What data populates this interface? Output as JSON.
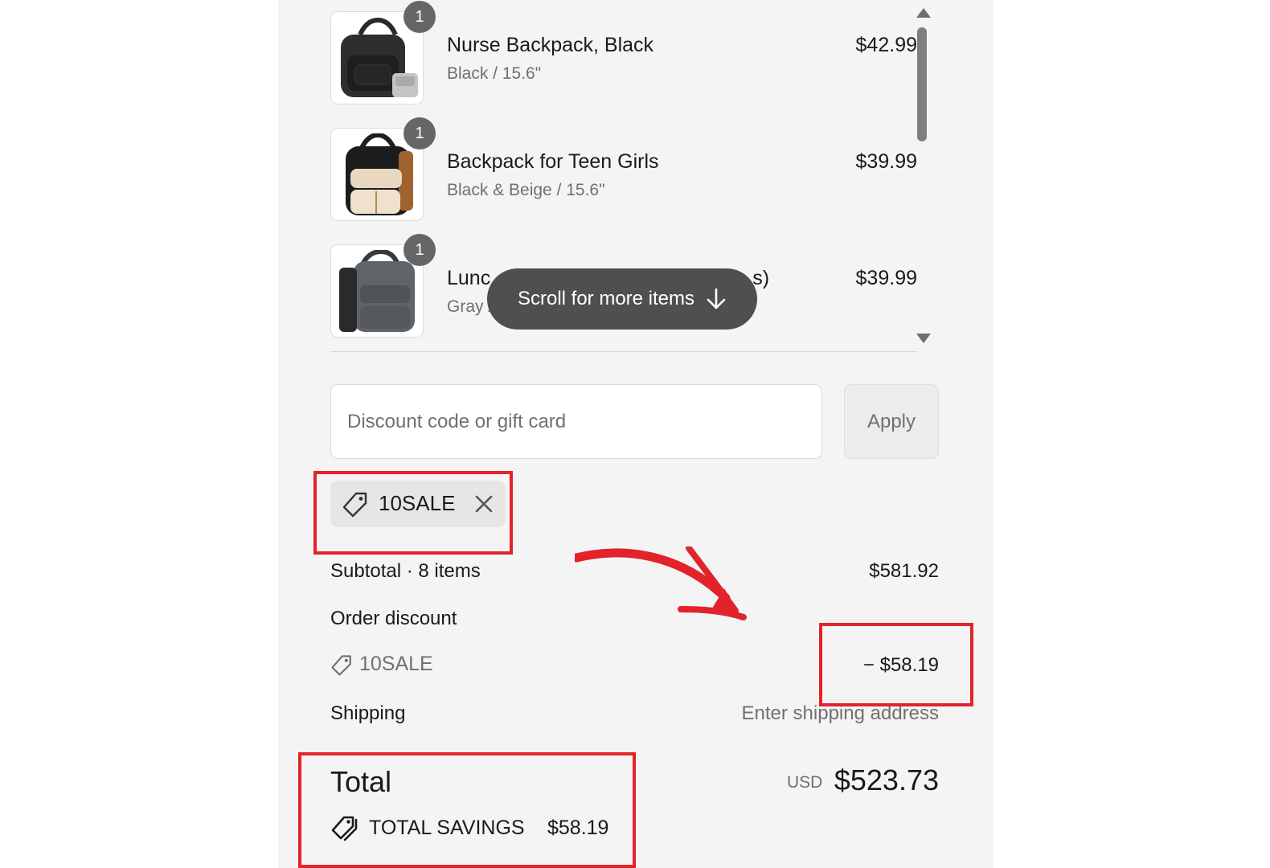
{
  "cart": {
    "items": [
      {
        "name": "Nurse Backpack, Black",
        "variant": "Black / 15.6\"",
        "price": "$42.99",
        "quantity": "1"
      },
      {
        "name": "Backpack for Teen Girls",
        "variant": "Black & Beige / 15.6\"",
        "price": "$39.99",
        "quantity": "1"
      },
      {
        "name_visible_start": "Lunc",
        "name_visible_end": "s)",
        "variant_visible": "Gray /",
        "price": "$39.99",
        "quantity": "1"
      }
    ],
    "scroll_hint": "Scroll for more items"
  },
  "discount": {
    "placeholder": "Discount code or gift card",
    "apply_label": "Apply",
    "applied_code": "10SALE"
  },
  "summary": {
    "subtotal_label": "Subtotal · 8 items",
    "subtotal_value": "$581.92",
    "order_discount_label": "Order discount",
    "order_discount_code": "10SALE",
    "order_discount_value": "− $58.19",
    "shipping_label": "Shipping",
    "shipping_value": "Enter shipping address",
    "total_label": "Total",
    "total_currency": "USD",
    "total_value": "$523.73",
    "savings_label": "TOTAL SAVINGS",
    "savings_value": "$58.19"
  },
  "colors": {
    "panel_background": "#f4f4f4",
    "quantity_badge": "#666666",
    "annotation_red": "#e3232b",
    "muted_text": "#707070"
  },
  "icons": [
    "tag-icon",
    "close-icon",
    "arrow-down-icon",
    "tags-icon",
    "annotation-arrow"
  ]
}
